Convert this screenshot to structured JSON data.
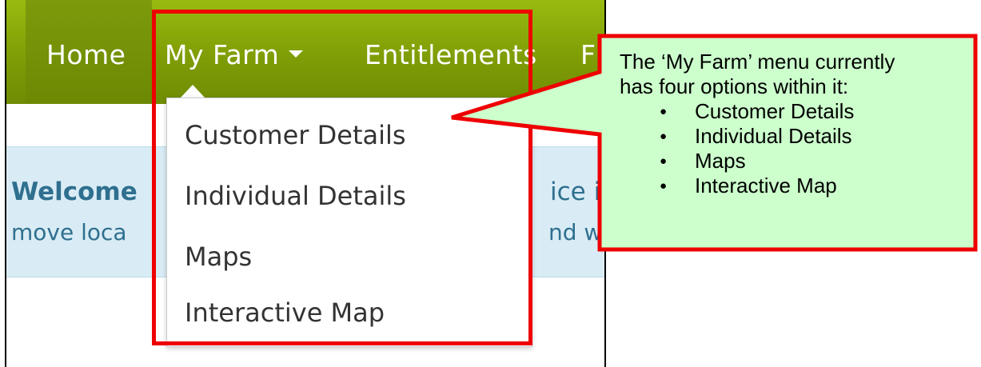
{
  "navbar": {
    "items": [
      {
        "label": "Home"
      },
      {
        "label": "My Farm"
      },
      {
        "label": "Entitlements"
      },
      {
        "label": "F"
      }
    ]
  },
  "banner": {
    "welcome_fragment": "Welcome",
    "right_fragment_1": "ice is",
    "move_fragment": "move loca",
    "right_fragment_2": "nd wh"
  },
  "dropdown": {
    "items": [
      {
        "label": "Customer Details"
      },
      {
        "label": "Individual Details"
      },
      {
        "label": "Maps"
      },
      {
        "label": "Interactive Map"
      }
    ]
  },
  "callout": {
    "intro_line_1": "The ‘My Farm’ menu currently",
    "intro_line_2": "has four options within it:",
    "bullets": [
      "Customer Details",
      "Individual Details",
      "Maps",
      "Interactive Map"
    ]
  },
  "colors": {
    "navbar": "#7f9d06",
    "highlight": "#ee0000",
    "callout_fill": "#ccffcc",
    "banner": "#d9ecf5",
    "banner_text": "#2f6f8f"
  }
}
